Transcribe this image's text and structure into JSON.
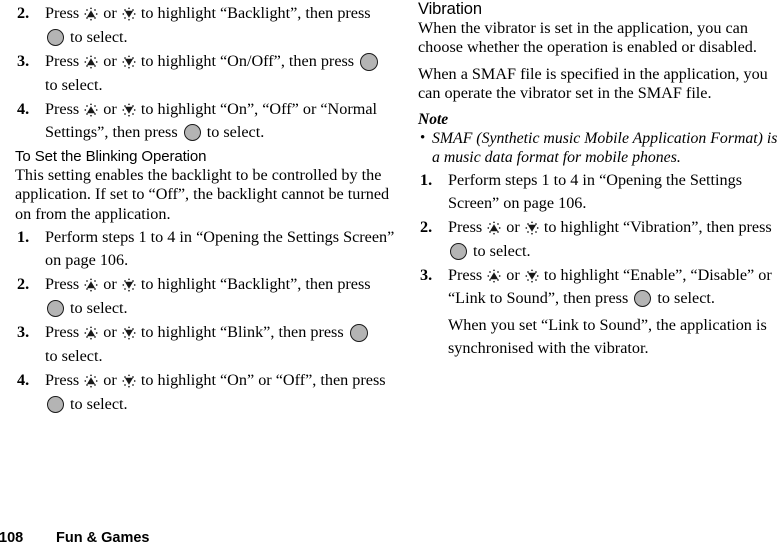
{
  "page": {
    "number": "108",
    "chapter": "Fun & Games"
  },
  "icons": {
    "up_key": "nav-up-key-icon",
    "down_key": "nav-down-key-icon",
    "select_key": "center-select-key-icon",
    "bullet": "•"
  },
  "left_column": {
    "steps_continued": [
      {
        "num": "2.",
        "line1_a": "Press",
        "line1_b": "or",
        "line1_c": "to highlight “Backlight”, then press",
        "line2": "to select."
      },
      {
        "num": "3.",
        "line1_a": "Press",
        "line1_b": "or",
        "line1_c": "to highlight “On/Off”, then press",
        "line2": "to select."
      },
      {
        "num": "4.",
        "line1_a": "Press",
        "line1_b": "or",
        "line1_c": "to highlight “On”, “Off” or “Normal Settings”, then press",
        "line2": "to select."
      }
    ],
    "section": {
      "heading": "To Set the Blinking Operation",
      "paragraph": "This setting enables the backlight to be controlled by the application. If set to “Off”, the backlight cannot be turned on from the application.",
      "steps": [
        {
          "num": "1.",
          "text": "Perform steps 1 to 4 in “Opening the Settings Screen” on page 106."
        },
        {
          "num": "2.",
          "line1_a": "Press",
          "line1_b": "or",
          "line1_c": "to highlight “Backlight”, then press",
          "line2": "to select."
        },
        {
          "num": "3.",
          "line1_a": "Press",
          "line1_b": "or",
          "line1_c": "to highlight “Blink”, then press",
          "line2": "to select."
        },
        {
          "num": "4.",
          "line1_a": "Press",
          "line1_b": "or",
          "line1_c": "to highlight “On” or “Off”, then press",
          "line2": "to select."
        }
      ]
    }
  },
  "right_column": {
    "heading": "Vibration",
    "paragraph_1": "When the vibrator is set in the application, you can choose whether the operation is enabled or disabled.",
    "paragraph_2": "When a SMAF file is specified in the application, you can operate the vibrator set in the SMAF file.",
    "note": {
      "label": "Note",
      "items": [
        "SMAF (Synthetic music Mobile Application Format) is a music data format for mobile phones."
      ]
    },
    "steps": [
      {
        "num": "1.",
        "text": "Perform steps 1 to 4 in “Opening the Settings Screen” on page 106."
      },
      {
        "num": "2.",
        "line1_a": "Press",
        "line1_b": "or",
        "line1_c": "to highlight “Vibration”, then press",
        "line2": "to select."
      },
      {
        "num": "3.",
        "line1_a": "Press",
        "line1_b": "or",
        "line1_c": "to highlight “Enable”, “Disable” or “Link to Sound”, then press",
        "line2": "to select.",
        "extra": "When you set “Link to Sound”, the application is synchronised with the vibrator."
      }
    ]
  }
}
